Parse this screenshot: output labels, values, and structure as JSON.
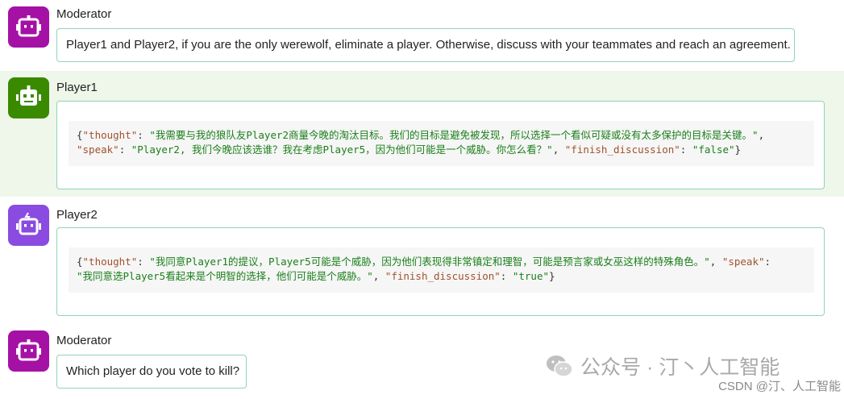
{
  "colors": {
    "moderator_avatar": "#a511a5",
    "player1_avatar": "#3a8a00",
    "player2_avatar": "#8a4be0",
    "player1_row_bg": "#eef7ea",
    "bubble_border": "#8fd3bd"
  },
  "messages": [
    {
      "sender": "Moderator",
      "text": "Player1 and Player2, if you are the only werewolf, eliminate a player. Otherwise, discuss with your teammates and reach an agreement."
    },
    {
      "sender": "Player1",
      "json": {
        "k1": "\"thought\"",
        "v1": "\"我需要与我的狼队友Player2商量今晚的淘汰目标。我们的目标是避免被发现，所以选择一个看似可疑或没有太多保护的目标是关键。\"",
        "k2": "\"speak\"",
        "v2": "\"Player2, 我们今晚应该选谁？我在考虑Player5，因为他们可能是一个威胁。你怎么看？\"",
        "k3": "\"finish_discussion\"",
        "v3": "\"false\""
      }
    },
    {
      "sender": "Player2",
      "json": {
        "k1": "\"thought\"",
        "v1": "\"我同意Player1的提议，Player5可能是个威胁，因为他们表现得非常镇定和理智，可能是预言家或女巫这样的特殊角色。\"",
        "k2": "\"speak\"",
        "v2": "\"我同意选Player5看起来是个明智的选择，他们可能是个威胁。\"",
        "k3": "\"finish_discussion\"",
        "v3": "\"true\""
      }
    },
    {
      "sender": "Moderator",
      "text": "Which player do you vote to kill?"
    }
  ],
  "watermark": {
    "text": "公众号 · 汀丶人工智能",
    "csdn": "CSDN @汀、人工智能"
  }
}
